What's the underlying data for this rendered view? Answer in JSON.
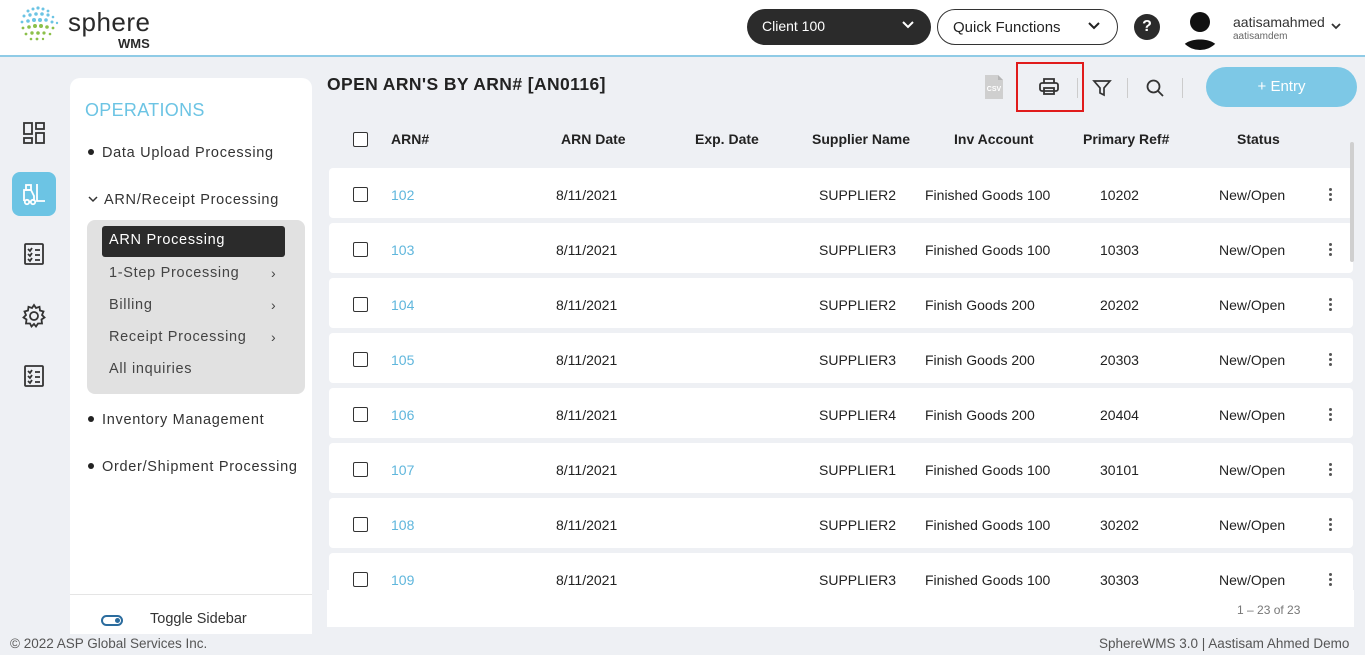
{
  "header": {
    "logo_text": "sphere",
    "logo_sub": "WMS",
    "client": "Client 100",
    "quick_functions": "Quick Functions",
    "help": "?",
    "user_name": "aatisamahmed",
    "user_sub": "aatisamdem"
  },
  "sidebar": {
    "title": "OPERATIONS",
    "items": [
      {
        "label": "Data Upload Processing"
      },
      {
        "label": "ARN/Receipt Processing"
      },
      {
        "label": "Inventory Management"
      },
      {
        "label": "Order/Shipment Processing"
      }
    ],
    "sub_items": [
      {
        "label": "ARN Processing"
      },
      {
        "label": "1-Step Processing"
      },
      {
        "label": "Billing"
      },
      {
        "label": "Receipt Processing"
      },
      {
        "label": "All inquiries"
      }
    ],
    "toggle_label": "Toggle Sidebar"
  },
  "main": {
    "title": "OPEN ARN'S BY ARN# [AN0116]",
    "csv_label": "CSV",
    "entry_button": "+ Entry",
    "columns": [
      "ARN#",
      "ARN Date",
      "Exp. Date",
      "Supplier Name",
      "Inv Account",
      "Primary Ref#",
      "Status"
    ],
    "rows": [
      {
        "arn": "102",
        "date": "8/11/2021",
        "exp": "",
        "supplier": "SUPPLIER2",
        "account": "Finished Goods 100",
        "ref": "10202",
        "status": "New/Open"
      },
      {
        "arn": "103",
        "date": "8/11/2021",
        "exp": "",
        "supplier": "SUPPLIER3",
        "account": "Finished Goods 100",
        "ref": "10303",
        "status": "New/Open"
      },
      {
        "arn": "104",
        "date": "8/11/2021",
        "exp": "",
        "supplier": "SUPPLIER2",
        "account": "Finish Goods 200",
        "ref": "20202",
        "status": "New/Open"
      },
      {
        "arn": "105",
        "date": "8/11/2021",
        "exp": "",
        "supplier": "SUPPLIER3",
        "account": "Finish Goods 200",
        "ref": "20303",
        "status": "New/Open"
      },
      {
        "arn": "106",
        "date": "8/11/2021",
        "exp": "",
        "supplier": "SUPPLIER4",
        "account": "Finish Goods 200",
        "ref": "20404",
        "status": "New/Open"
      },
      {
        "arn": "107",
        "date": "8/11/2021",
        "exp": "",
        "supplier": "SUPPLIER1",
        "account": "Finished Goods 100",
        "ref": "30101",
        "status": "New/Open"
      },
      {
        "arn": "108",
        "date": "8/11/2021",
        "exp": "",
        "supplier": "SUPPLIER2",
        "account": "Finished Goods 100",
        "ref": "30202",
        "status": "New/Open"
      },
      {
        "arn": "109",
        "date": "8/11/2021",
        "exp": "",
        "supplier": "SUPPLIER3",
        "account": "Finished Goods 100",
        "ref": "30303",
        "status": "New/Open"
      }
    ],
    "pagination": "1 – 23 of 23"
  },
  "footer": {
    "copyright": "© 2022 ASP Global Services Inc.",
    "version": "SphereWMS 3.0 | Aastisam Ahmed Demo"
  },
  "colors": {
    "accent": "#6cc4e4",
    "dark": "#2b2b2b",
    "link": "#5fb6dc",
    "highlight": "#e01b1b"
  }
}
